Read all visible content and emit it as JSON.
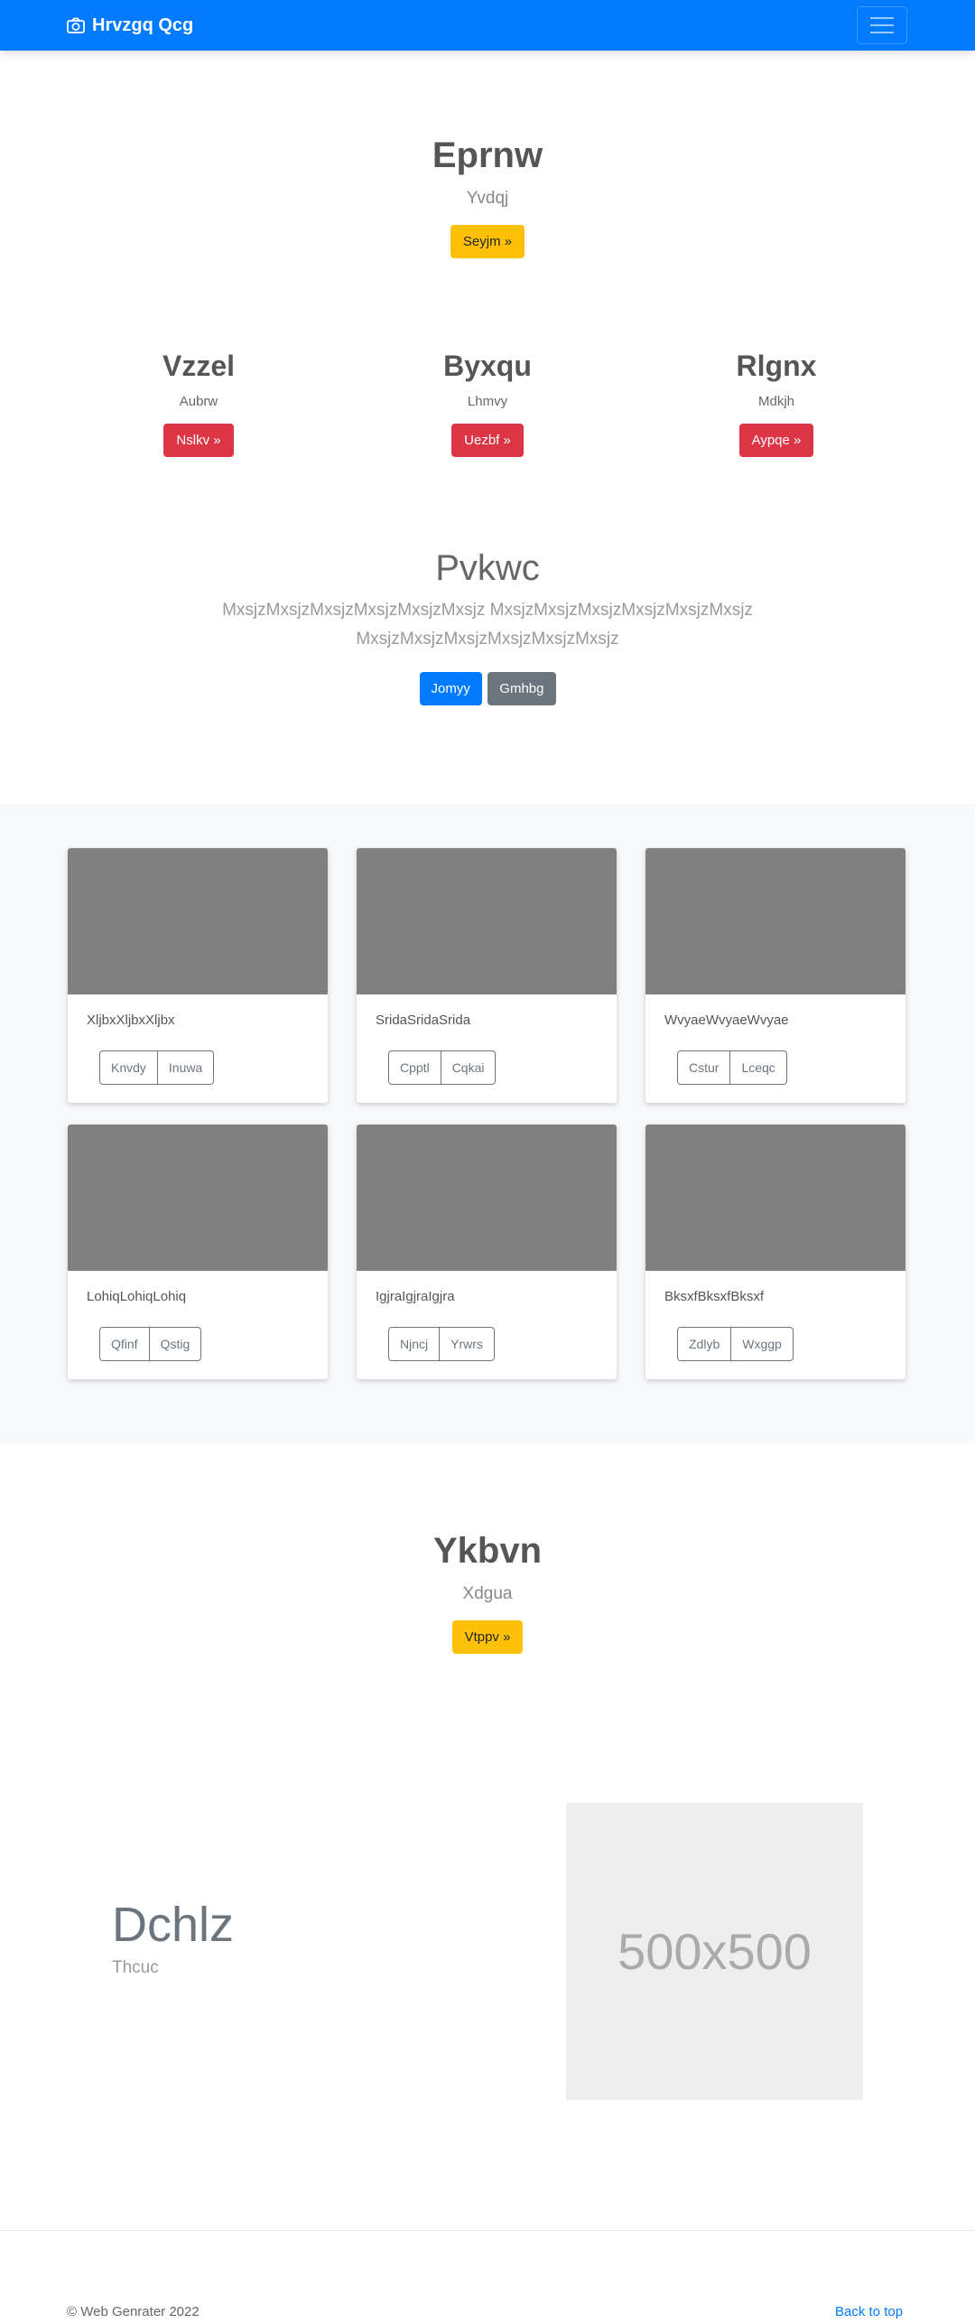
{
  "navbar": {
    "brand": "Hrvzgq Qcg",
    "brand_icon": "camera-icon",
    "toggler_icon": "menu-icon",
    "bg_color": "#007bff"
  },
  "hero": {
    "title": "Eprnw",
    "subtitle": "Yvdqj",
    "button": "Seyjm »"
  },
  "columns": [
    {
      "title": "Vzzel",
      "subtitle": "Aubrw",
      "button": "Nslkv »"
    },
    {
      "title": "Byxqu",
      "subtitle": "Lhmvy",
      "button": "Uezbf »"
    },
    {
      "title": "Rlgnx",
      "subtitle": "Mdkjh",
      "button": "Aypqe »"
    }
  ],
  "lead": {
    "title": "Pvkwc",
    "line1": "MxsjzMxsjzMxsjzMxsjzMxsjzMxsjz MxsjzMxsjzMxsjzMxsjzMxsjzMxsjz",
    "line2": "MxsjzMxsjzMxsjzMxsjzMxsjzMxsjz",
    "primary_button": "Jomyy",
    "secondary_button": "Gmhbg"
  },
  "cards": [
    {
      "text": "XljbxXljbxXljbx",
      "btn1": "Knvdy",
      "btn2": "Inuwa"
    },
    {
      "text": "SridaSridaSrida",
      "btn1": "Cpptl",
      "btn2": "Cqkai"
    },
    {
      "text": "WvyaeWvyaeWvyae",
      "btn1": "Cstur",
      "btn2": "Lceqc"
    },
    {
      "text": "LohiqLohiqLohiq",
      "btn1": "Qfinf",
      "btn2": "Qstig"
    },
    {
      "text": "IgjraIgjraIgjra",
      "btn1": "Njncj",
      "btn2": "Yrwrs"
    },
    {
      "text": "BksxfBksxfBksxf",
      "btn1": "Zdlyb",
      "btn2": "Wxggp"
    }
  ],
  "section2": {
    "title": "Ykbvn",
    "subtitle": "Xdgua",
    "button": "Vtppv »"
  },
  "feature": {
    "title": "Dchlz",
    "subtitle": "Thcuc",
    "placeholder": "500x500"
  },
  "footer": {
    "copyright": "© Web Genrater 2022",
    "back_to_top": "Back to top"
  }
}
